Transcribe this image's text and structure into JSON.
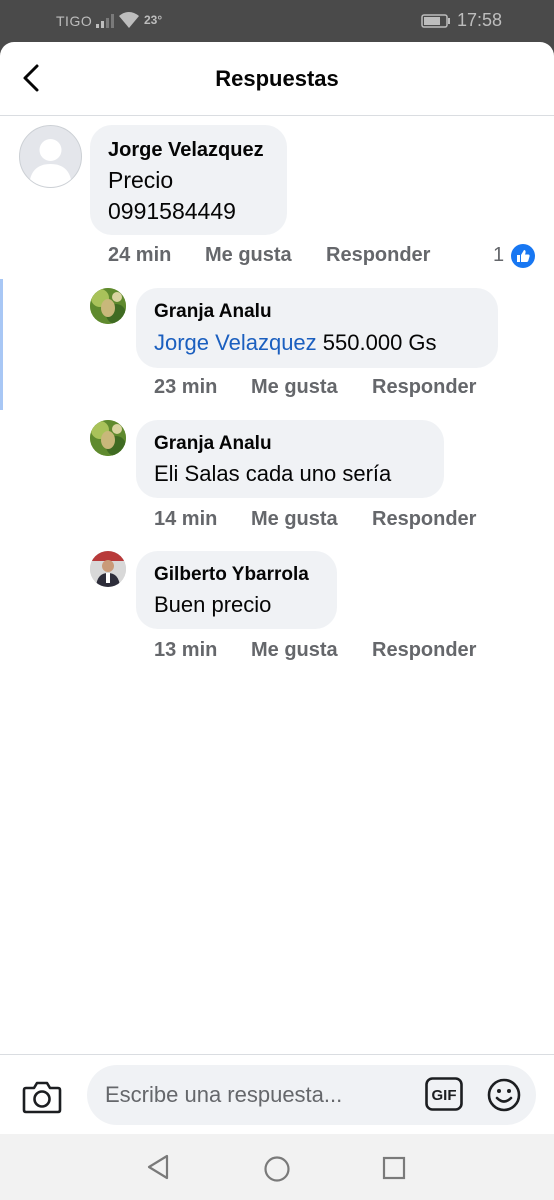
{
  "status_bar": {
    "carrier": "TIGO",
    "temperature": "23°",
    "time": "17:58"
  },
  "header": {
    "title": "Respuestas"
  },
  "comment": {
    "author": "Jorge Velazquez",
    "lines": [
      "Precio",
      "0991584449"
    ],
    "time": "24 min",
    "like_label": "Me gusta",
    "reply_label": "Responder",
    "reaction_count": "1"
  },
  "replies": [
    {
      "author": "Granja Analu",
      "mention": "Jorge Velazquez",
      "text": "550.000 Gs",
      "time": "23 min",
      "like_label": "Me gusta",
      "reply_label": "Responder"
    },
    {
      "author": "Granja Analu",
      "text": "Eli Salas cada uno sería",
      "time": "14 min",
      "like_label": "Me gusta",
      "reply_label": "Responder"
    },
    {
      "author": "Gilberto Ybarrola",
      "text": "Buen precio",
      "time": "13 min",
      "like_label": "Me gusta",
      "reply_label": "Responder"
    }
  ],
  "composer": {
    "placeholder": "Escribe una respuesta...",
    "gif_label": "GIF"
  },
  "colors": {
    "bubble": "#f0f2f5",
    "mention": "#1b5fbf",
    "like_blue": "#1877f2",
    "meta_gray": "#65676b"
  }
}
